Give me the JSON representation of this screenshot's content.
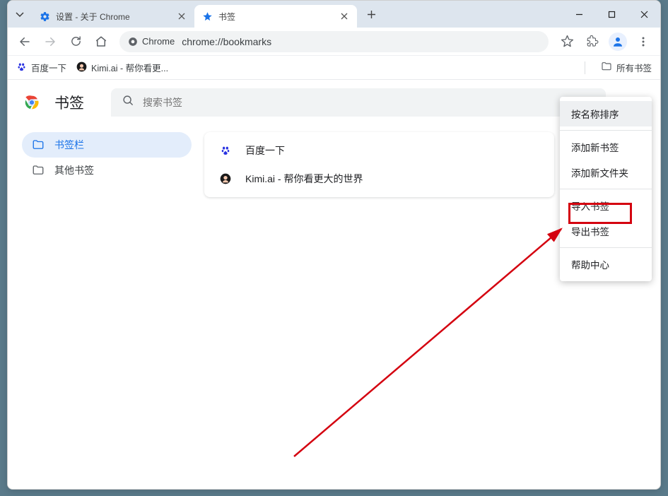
{
  "tabs": [
    {
      "title": "设置 - 关于 Chrome",
      "icon": "gear"
    },
    {
      "title": "书签",
      "icon": "star"
    }
  ],
  "omnibox": {
    "chip": "Chrome",
    "url": "chrome://bookmarks"
  },
  "bookmarks_bar": {
    "items": [
      {
        "label": "百度一下",
        "icon": "baidu"
      },
      {
        "label": "Kimi.ai - 帮你看更...",
        "icon": "kimi"
      }
    ],
    "all_label": "所有书签"
  },
  "page": {
    "title": "书签",
    "search_placeholder": "搜索书签"
  },
  "sidebar": {
    "items": [
      {
        "label": "书签栏",
        "active": true
      },
      {
        "label": "其他书签",
        "active": false
      }
    ]
  },
  "list": [
    {
      "label": "百度一下",
      "icon": "baidu"
    },
    {
      "label": "Kimi.ai - 帮你看更大的世界",
      "icon": "kimi"
    }
  ],
  "menu": {
    "items": [
      {
        "label": "按名称排序",
        "hover": true
      },
      {
        "label": "添加新书签"
      },
      {
        "label": "添加新文件夹"
      },
      {
        "label": "导入书签",
        "highlight": true
      },
      {
        "label": "导出书签"
      },
      {
        "label": "帮助中心"
      }
    ]
  }
}
